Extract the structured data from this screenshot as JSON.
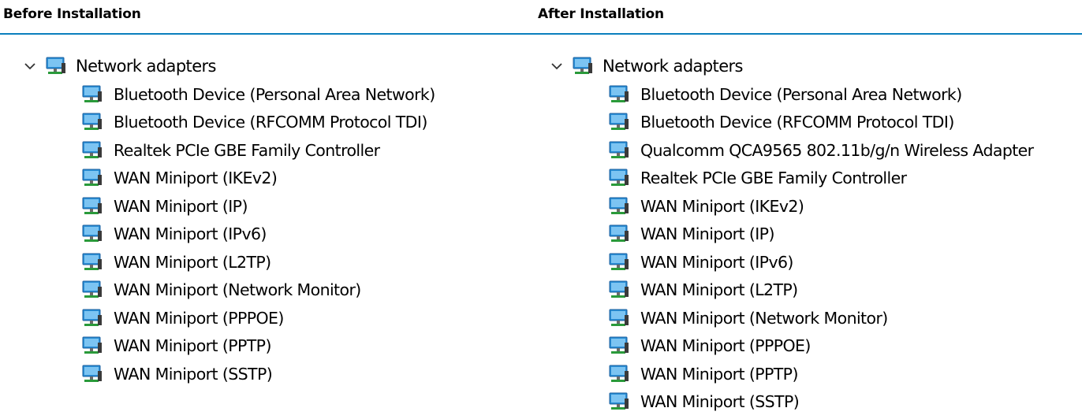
{
  "headers": {
    "before": "Before Installation",
    "after": "After Installation"
  },
  "colors": {
    "divider": "#0a7fbd",
    "icon_screen": "#2a8fd6",
    "icon_base": "#2a9a3a"
  },
  "icons": {
    "expand": "chevron-down-icon",
    "device": "network-adapter-icon"
  },
  "before": {
    "category": "Network adapters",
    "devices": [
      "Bluetooth Device (Personal Area Network)",
      "Bluetooth Device (RFCOMM Protocol TDI)",
      "Realtek PCIe GBE Family Controller",
      "WAN Miniport (IKEv2)",
      "WAN Miniport (IP)",
      "WAN Miniport (IPv6)",
      "WAN Miniport (L2TP)",
      "WAN Miniport (Network Monitor)",
      "WAN Miniport (PPPOE)",
      "WAN Miniport (PPTP)",
      "WAN Miniport (SSTP)"
    ]
  },
  "after": {
    "category": "Network adapters",
    "devices": [
      "Bluetooth Device (Personal Area Network)",
      "Bluetooth Device (RFCOMM Protocol TDI)",
      "Qualcomm QCA9565 802.11b/g/n Wireless Adapter",
      "Realtek PCIe GBE Family Controller",
      "WAN Miniport (IKEv2)",
      "WAN Miniport (IP)",
      "WAN Miniport (IPv6)",
      "WAN Miniport (L2TP)",
      "WAN Miniport (Network Monitor)",
      "WAN Miniport (PPPOE)",
      "WAN Miniport (PPTP)",
      "WAN Miniport (SSTP)"
    ]
  }
}
